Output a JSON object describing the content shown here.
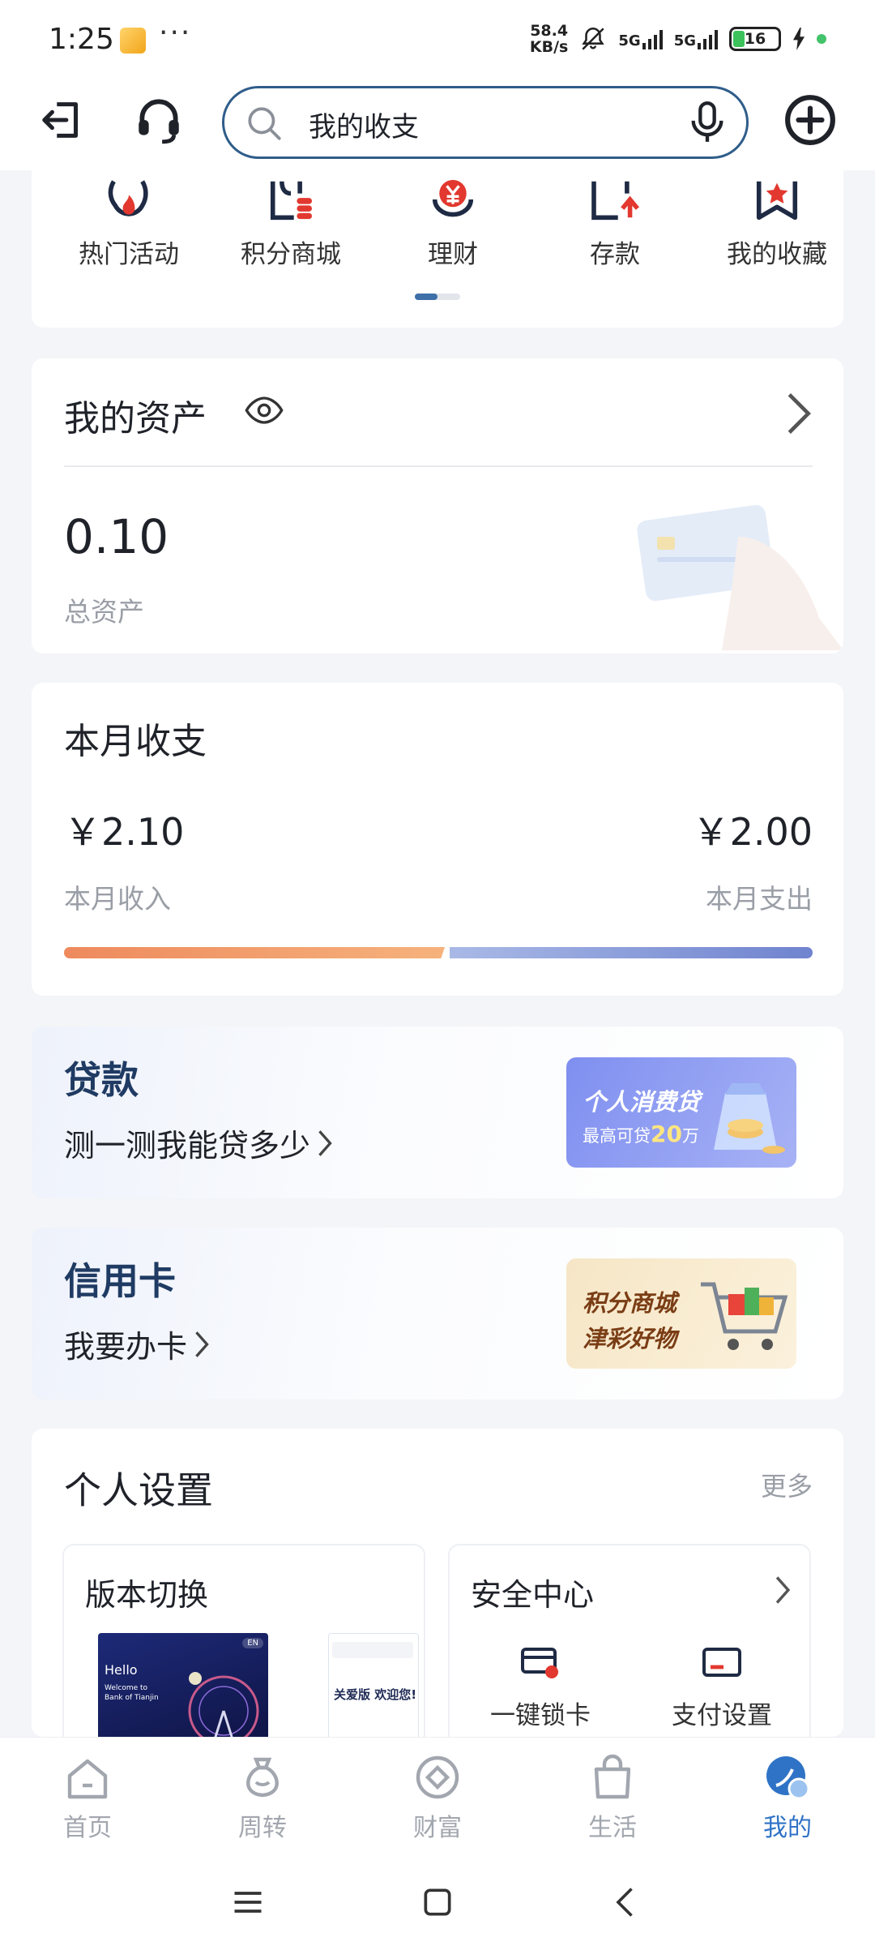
{
  "status_bar": {
    "time": "1:25",
    "net_speed_value": "58.4",
    "net_speed_unit": "KB/s",
    "signal1": "5G",
    "signal2": "5G",
    "battery": "16"
  },
  "search": {
    "text": "我的收支"
  },
  "quick_menu": {
    "items": [
      {
        "label": "热门活动",
        "icon": "fire-icon"
      },
      {
        "label": "积分商城",
        "icon": "points-mall-icon"
      },
      {
        "label": "理财",
        "icon": "wealth-yen-icon"
      },
      {
        "label": "存款",
        "icon": "deposit-icon"
      },
      {
        "label": "我的收藏",
        "icon": "bookmark-icon"
      }
    ]
  },
  "assets": {
    "title": "我的资产",
    "amount": "0.10",
    "label": "总资产"
  },
  "monthly": {
    "title": "本月收支",
    "income": "￥2.10",
    "income_label": "本月收入",
    "expense": "￥2.00",
    "expense_label": "本月支出",
    "income_share": 0.512
  },
  "loan": {
    "title": "贷款",
    "link": "测一测我能贷多少",
    "banner_title": "个人消费贷",
    "banner_prefix": "最高可贷",
    "banner_amount": "20",
    "banner_suffix": "万"
  },
  "credit": {
    "title": "信用卡",
    "link": "我要办卡",
    "banner_line1": "积分商城",
    "banner_line2": "津彩好物"
  },
  "settings": {
    "title": "个人设置",
    "more": "更多",
    "version": {
      "title": "版本切换",
      "preview_hello": "Hello",
      "preview_welcome1": "Welcome to",
      "preview_welcome2": "Bank of Tianjin",
      "preview_lang": "EN",
      "preview_care": "关爱版 欢迎您!"
    },
    "security": {
      "title": "安全中心",
      "items": [
        {
          "label": "一键锁卡"
        },
        {
          "label": "支付设置"
        }
      ]
    }
  },
  "bottom_nav": {
    "items": [
      {
        "label": "首页",
        "active": false
      },
      {
        "label": "周转",
        "active": false
      },
      {
        "label": "财富",
        "active": false
      },
      {
        "label": "生活",
        "active": false
      },
      {
        "label": "我的",
        "active": true
      }
    ]
  },
  "colors": {
    "accent": "#2f73c6",
    "search_border": "#2f5d8a",
    "quick_icon_dark": "#1f2a44",
    "quick_icon_red": "#e2382f",
    "income_bar": "#ee8a5d",
    "expense_bar": "#7386d0"
  }
}
